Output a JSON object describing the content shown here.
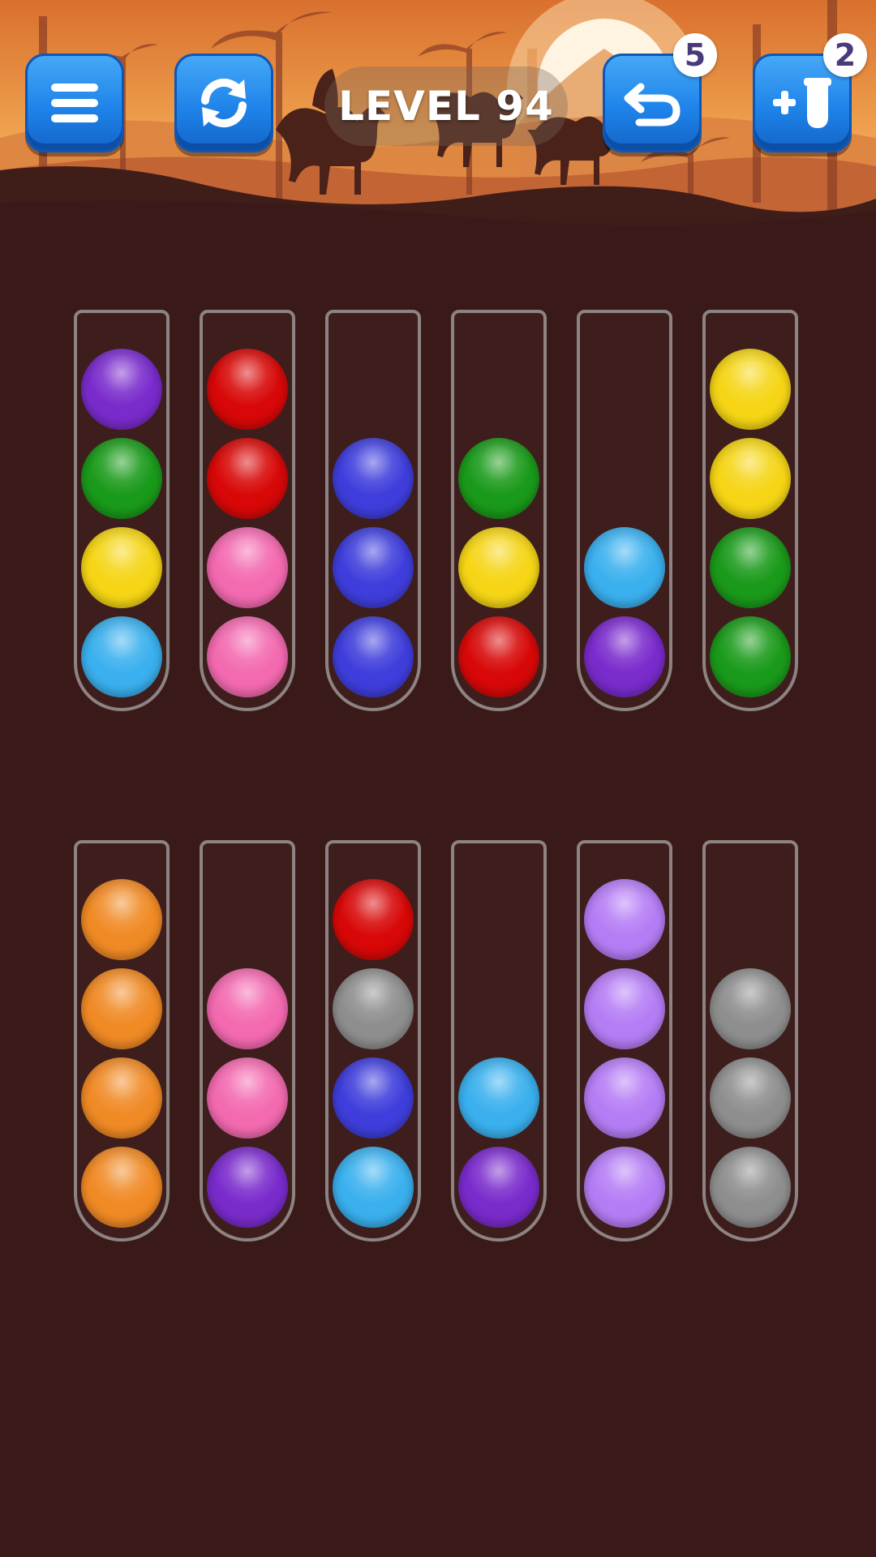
{
  "header": {
    "level_label": "LEVEL 94",
    "undo_count": "5",
    "add_tube_count": "2",
    "buttons": [
      {
        "name": "menu-button",
        "icon": "hamburger-menu-icon"
      },
      {
        "name": "restart-button",
        "icon": "refresh-icon"
      },
      {
        "name": "undo-button",
        "icon": "undo-arrow-icon"
      },
      {
        "name": "add-tube-button",
        "icon": "plus-tube-icon"
      }
    ]
  },
  "colors": {
    "purple": "#7a2bcc",
    "green": "#1a9a1a",
    "yellow": "#f5d515",
    "sky": "#3ab0ee",
    "red": "#d80808",
    "pink": "#f36ab0",
    "blue": "#3f3edc",
    "orange": "#f08a25",
    "lavender": "#b57df5",
    "gray": "#8e8e8e"
  },
  "tubes_top_row": [
    {
      "balls": [
        "sky",
        "yellow",
        "green",
        "purple"
      ]
    },
    {
      "balls": [
        "pink",
        "pink",
        "red",
        "red"
      ]
    },
    {
      "balls": [
        "blue",
        "blue",
        "blue"
      ]
    },
    {
      "balls": [
        "red",
        "yellow",
        "green"
      ]
    },
    {
      "balls": [
        "purple",
        "sky"
      ]
    },
    {
      "balls": [
        "green",
        "green",
        "yellow",
        "yellow"
      ]
    }
  ],
  "tubes_bottom_row": [
    {
      "balls": [
        "orange",
        "orange",
        "orange",
        "orange"
      ]
    },
    {
      "balls": [
        "purple",
        "pink",
        "pink"
      ]
    },
    {
      "balls": [
        "sky",
        "blue",
        "gray",
        "red"
      ]
    },
    {
      "balls": [
        "purple",
        "sky"
      ]
    },
    {
      "balls": [
        "lavender",
        "lavender",
        "lavender",
        "lavender"
      ]
    },
    {
      "balls": [
        "gray",
        "gray",
        "gray"
      ]
    }
  ]
}
